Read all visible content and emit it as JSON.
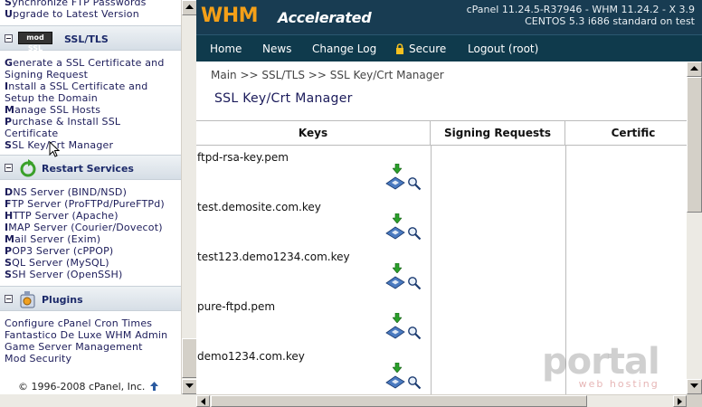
{
  "left": {
    "top_links": [
      {
        "b": "S",
        "rest": "ynchronize FTP Passwords"
      },
      {
        "b": "U",
        "rest": "pgrade to Latest Version"
      }
    ],
    "ssl": {
      "title": "SSL/TLS",
      "badge": "mod SSL",
      "links": [
        {
          "b": "G",
          "rest": "enerate a SSL Certificate and"
        },
        {
          "b": "",
          "rest": "Signing Request"
        },
        {
          "b": "I",
          "rest": "nstall a SSL Certificate and"
        },
        {
          "b": "",
          "rest": "Setup the Domain"
        },
        {
          "b": "M",
          "rest": "anage SSL Hosts"
        },
        {
          "b": "P",
          "rest": "urchase & Install SSL"
        },
        {
          "b": "",
          "rest": "Certificate"
        },
        {
          "b": "S",
          "rest": "SL Key/Crt Manager"
        }
      ]
    },
    "restart": {
      "title": "Restart Services",
      "links": [
        {
          "b": "D",
          "rest": "NS Server (BIND/NSD)"
        },
        {
          "b": "F",
          "rest": "TP Server (ProFTPd/PureFTPd)"
        },
        {
          "b": "H",
          "rest": "TTP Server (Apache)"
        },
        {
          "b": "I",
          "rest": "MAP Server (Courier/Dovecot)"
        },
        {
          "b": "M",
          "rest": "ail Server (Exim)"
        },
        {
          "b": "P",
          "rest": "OP3 Server (cPPOP)"
        },
        {
          "b": "S",
          "rest": "QL Server (MySQL)"
        },
        {
          "b": "S",
          "rest": "SH Server (OpenSSH)"
        }
      ]
    },
    "plugins": {
      "title": "Plugins",
      "links": [
        {
          "b": "",
          "rest": "Configure cPanel Cron Times"
        },
        {
          "b": "",
          "rest": "Fantastico De Luxe WHM Admin"
        },
        {
          "b": "",
          "rest": "Game Server Management"
        },
        {
          "b": "",
          "rest": "Mod Security"
        }
      ]
    },
    "copyright": "© 1996-2008 cPanel, Inc."
  },
  "header": {
    "logo_main": "WHM",
    "logo_sub": "Accelerated",
    "version_line1": "cPanel 11.24.5-R37946 - WHM 11.24.2 - X 3.9",
    "version_line2": "CENTOS 5.3 i686 standard on test"
  },
  "nav": {
    "items": [
      "Home",
      "News",
      "Change Log",
      "Secure",
      "Logout (root)"
    ]
  },
  "main": {
    "breadcrumb": "Main >> SSL/TLS >> SSL Key/Crt Manager",
    "title": "SSL Key/Crt Manager",
    "columns": [
      "Keys",
      "Signing Requests",
      "Certific"
    ],
    "keys": [
      "ftpd-rsa-key.pem",
      "test.demosite.com.key",
      "test123.demo1234.com.key",
      "pure-ftpd.pem",
      "demo1234.com.key"
    ]
  },
  "watermark": {
    "big": "portal",
    "small": "web hosting"
  },
  "colors": {
    "banner": "#183c52",
    "nav": "#0f3a4c",
    "logo": "#f4a018",
    "link": "#1c1c5a"
  }
}
